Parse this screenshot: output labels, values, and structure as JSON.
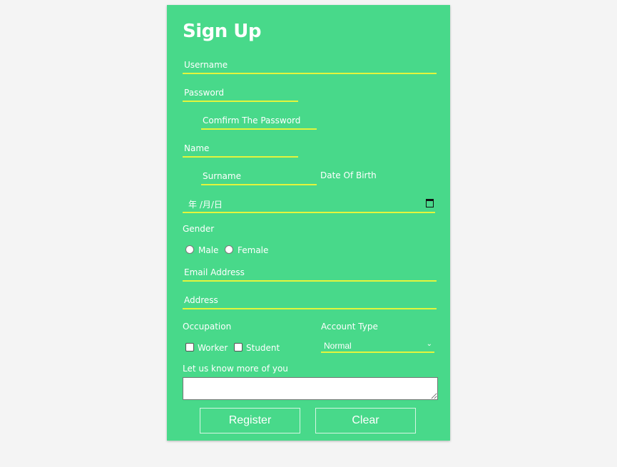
{
  "title": "Sign Up",
  "fields": {
    "username": "Username",
    "password": "Password",
    "confirm": "Comfirm The Password",
    "name": "Name",
    "surname": "Surname",
    "dob_label": "Date Of Birth",
    "dob_placeholder": "年  /月/日",
    "email": "Email Address",
    "address": "Address"
  },
  "gender": {
    "label": "Gender",
    "options": [
      "Male",
      "Female"
    ]
  },
  "occupation": {
    "label": "Occupation",
    "options": [
      "Worker",
      "Student"
    ]
  },
  "account_type": {
    "label": "Account Type",
    "selected": "Normal"
  },
  "about": {
    "label": "Let us know more of you",
    "value": ""
  },
  "buttons": {
    "register": "Register",
    "clear": "Clear"
  },
  "icons": {
    "date": "calendar-icon",
    "select": "chevron-down-icon"
  },
  "colors": {
    "background": "#48d98a",
    "underline": "#e3f53c",
    "text": "#ffffff"
  }
}
